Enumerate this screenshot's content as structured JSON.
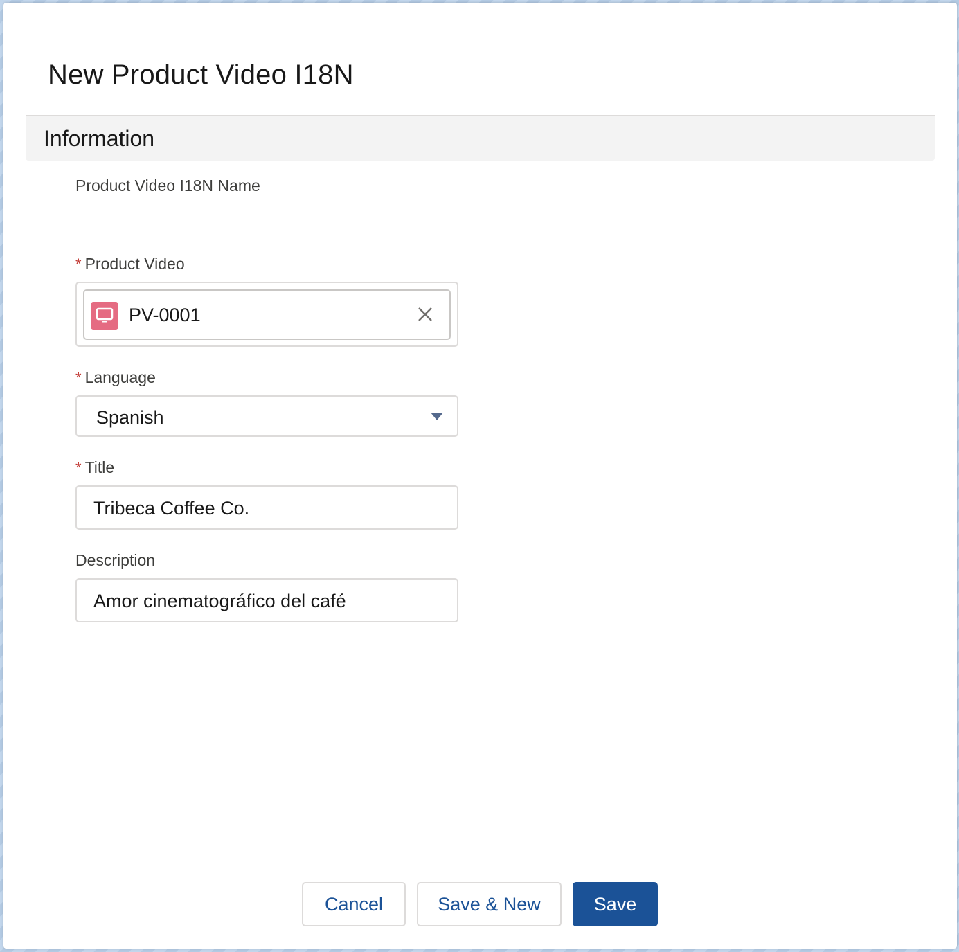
{
  "modal": {
    "title": "New Product Video I18N"
  },
  "section": {
    "title": "Information"
  },
  "fields": {
    "name_label": "Product Video I18N Name",
    "product_video": {
      "required_marker": "*",
      "label": "Product Video",
      "value": "PV-0001",
      "icon": "product-video-icon"
    },
    "language": {
      "required_marker": "*",
      "label": "Language",
      "value": "Spanish"
    },
    "title": {
      "required_marker": "*",
      "label": "Title",
      "value": "Tribeca Coffee Co."
    },
    "description": {
      "label": "Description",
      "value": "Amor cinematográfico del café"
    }
  },
  "footer": {
    "cancel_label": "Cancel",
    "save_new_label": "Save & New",
    "save_label": "Save"
  },
  "colors": {
    "brand": "#1b5297",
    "required": "#c23934",
    "pill_icon_bg": "#e56b82"
  }
}
